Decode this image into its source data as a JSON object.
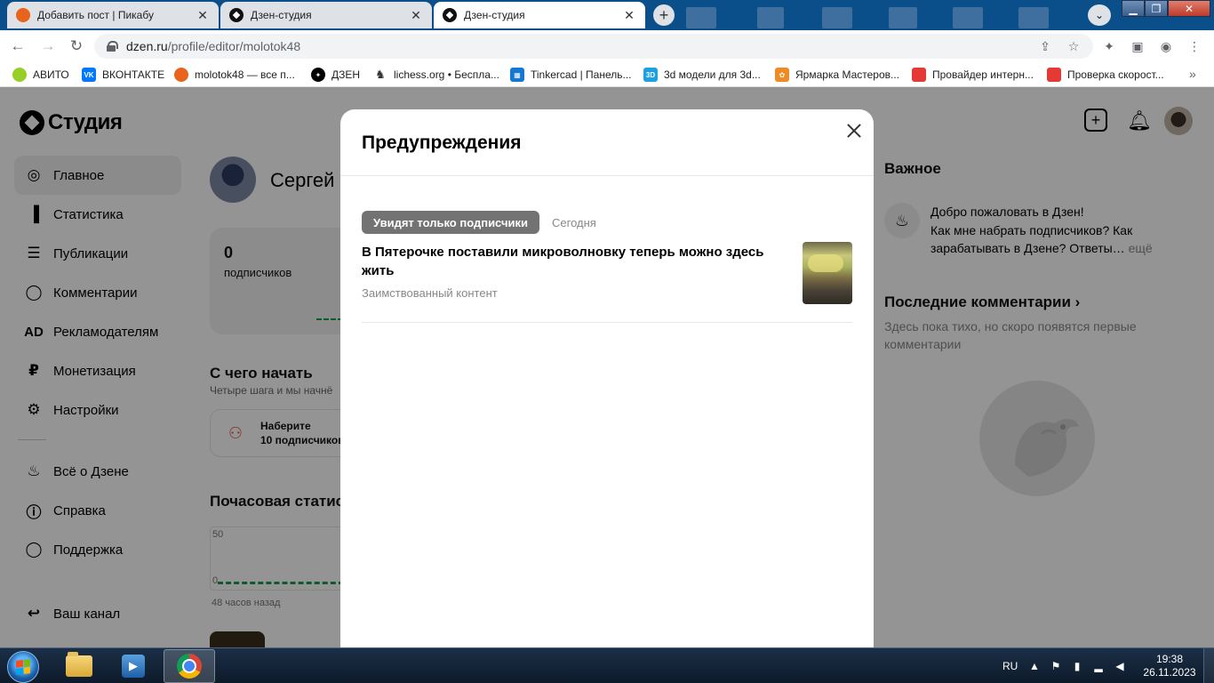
{
  "browser": {
    "tabs": [
      {
        "title": "Добавить пост | Пикабу",
        "favicon": "pikabu-icon",
        "active": false
      },
      {
        "title": "Дзен-студия",
        "favicon": "zen-icon",
        "active": false
      },
      {
        "title": "Дзен-студия",
        "favicon": "zen-icon",
        "active": true
      }
    ],
    "address": {
      "host": "dzen.ru",
      "path": "/profile/editor/molotok48"
    },
    "bookmarks": [
      {
        "label": "АВИТО",
        "icon": "avito-icon",
        "color": "#97cf26"
      },
      {
        "label": "ВКОНТАКТЕ",
        "icon": "vk-icon",
        "color": "#0077ff"
      },
      {
        "label": "molotok48 — все п...",
        "icon": "pikabu-icon",
        "color": "#e8631c"
      },
      {
        "label": "ДЗЕН",
        "icon": "zen-icon",
        "color": "#000000"
      },
      {
        "label": "lichess.org • Беспла...",
        "icon": "lichess-icon",
        "color": "#555555"
      },
      {
        "label": "Tinkercad | Панель...",
        "icon": "tinkercad-icon",
        "color": "#1477d1"
      },
      {
        "label": "3d модели для 3d...",
        "icon": "3d-icon",
        "color": "#1ba1e2"
      },
      {
        "label": "Ярмарка Мастеров...",
        "icon": "livemaster-icon",
        "color": "#f08a24"
      },
      {
        "label": "Провайдер интерн...",
        "icon": "provider-icon",
        "color": "#e53935"
      },
      {
        "label": "Проверка скорост...",
        "icon": "speedtest-icon",
        "color": "#e53935"
      }
    ]
  },
  "studio": {
    "logo": "Студия",
    "nav": [
      {
        "label": "Главное",
        "icon": "planet-icon",
        "active": true
      },
      {
        "label": "Статистика",
        "icon": "bar-chart-icon"
      },
      {
        "label": "Публикации",
        "icon": "publications-icon"
      },
      {
        "label": "Комментарии",
        "icon": "comment-icon"
      },
      {
        "label": "Рекламодателям",
        "icon": "ad-icon",
        "glyph": "AD"
      },
      {
        "label": "Монетизация",
        "icon": "ruble-icon",
        "glyph": "₽"
      },
      {
        "label": "Настройки",
        "icon": "gear-icon"
      },
      {
        "label": "Всё о Дзене",
        "icon": "flame-icon"
      },
      {
        "label": "Справка",
        "icon": "help-icon"
      },
      {
        "label": "Поддержка",
        "icon": "support-icon"
      },
      {
        "label": "Ваш канал",
        "icon": "channel-icon"
      }
    ],
    "user_name": "Сергей",
    "stats": {
      "subscribers": "0",
      "subscribers_label": "подписчиков"
    },
    "start": {
      "title": "С чего начать",
      "subtitle": "Четыре шага и мы начнё",
      "step_line1": "Наберите",
      "step_line2": "10 подписчиков"
    },
    "hourly": {
      "title": "Почасовая статис",
      "tick_top": "50",
      "tick_bottom": "0",
      "footer": "48 часов назад"
    },
    "important": {
      "title": "Важное",
      "item_title": "Добро пожаловать в Дзен!",
      "item_text": "Как мне набрать подписчиков? Как зарабатывать в Дзене? Ответы…",
      "item_more": "ещё"
    },
    "comments": {
      "title": "Последние комментарии",
      "empty_text": "Здесь пока тихо, но скоро появятся первые комментарии"
    }
  },
  "modal": {
    "title": "Предупреждения",
    "warning": {
      "badge": "Увидят только подписчики",
      "date": "Сегодня",
      "title": "В Пятерочке поставили микроволновку теперь можно здесь жить",
      "reason": "Заимствованный контент"
    }
  },
  "taskbar": {
    "lang": "RU",
    "time": "19:38",
    "date": "26.11.2023"
  }
}
